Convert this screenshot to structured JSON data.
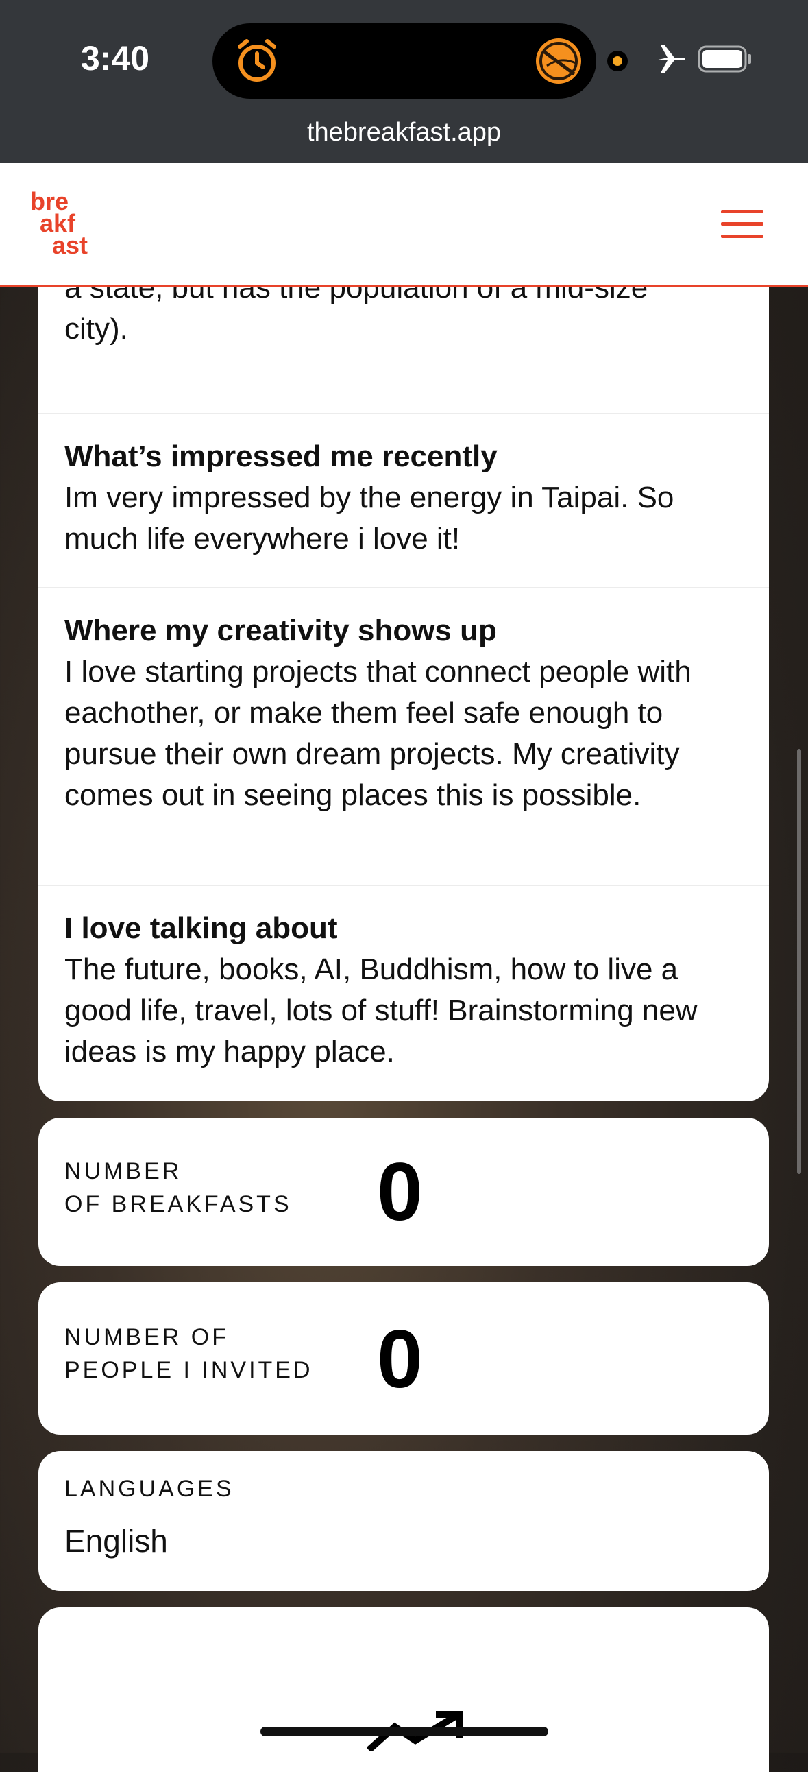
{
  "status_bar": {
    "time": "3:40",
    "icons": [
      "alarm-icon",
      "activity-icon",
      "camera-indicator-dot",
      "airplane-icon",
      "battery-icon"
    ],
    "url": "thebreakfast.app"
  },
  "nav": {
    "logo_lines": [
      "bre",
      "akf",
      "ast"
    ],
    "menu_icon": "hamburger-menu-icon",
    "accent_color": "#e8432a"
  },
  "profile": {
    "partial_text": "San Francisco, Oakland, Boston, Vermont (it's a state, but has the population of a mid-size city).",
    "partial_visible_line1": "a state, but has the population of a mid-size",
    "partial_visible_line2": "city).",
    "sections": [
      {
        "heading": "What’s impressed me recently",
        "body": "Im very impressed by the energy in Taipai. So much life everywhere i love it!"
      },
      {
        "heading": "Where my creativity shows up",
        "body": "I love starting projects that connect people with eachother, or make them feel safe enough to pursue their own dream projects. My creativity comes out in seeing places this is possible."
      },
      {
        "heading": "I love talking about",
        "body": "The future, books, AI, Buddhism, how to live a good life, travel, lots of stuff! Brainstorming new ideas is my happy place."
      }
    ]
  },
  "stats": {
    "breakfasts": {
      "label_line1": "NUMBER",
      "label_line2": "OF BREAKFASTS",
      "value": "0"
    },
    "invited": {
      "label_line1": "NUMBER OF",
      "label_line2": "PEOPLE I INVITED",
      "value": "0"
    }
  },
  "languages": {
    "label": "LANGUAGES",
    "value": "English"
  }
}
